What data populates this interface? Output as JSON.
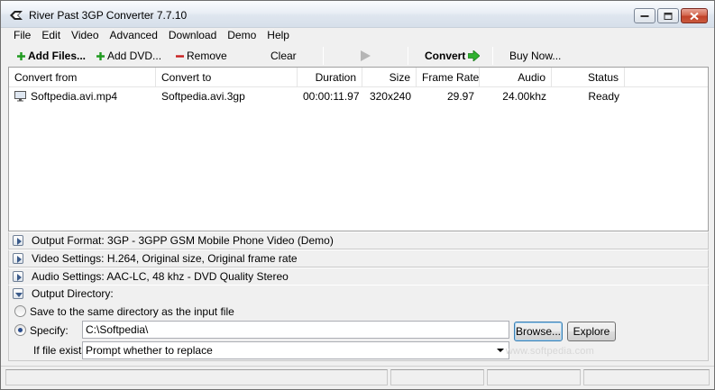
{
  "window": {
    "title": "River Past 3GP Converter 7.7.10"
  },
  "menu": [
    "File",
    "Edit",
    "Video",
    "Advanced",
    "Download",
    "Demo",
    "Help"
  ],
  "toolbar": {
    "add_files": "Add Files...",
    "add_dvd": "Add DVD...",
    "remove": "Remove",
    "clear": "Clear",
    "convert": "Convert",
    "buy_now": "Buy Now..."
  },
  "list": {
    "columns": [
      "Convert from",
      "Convert to",
      "Duration",
      "Size",
      "Frame Rate",
      "Audio",
      "Status"
    ],
    "rows": [
      {
        "from": "Softpedia.avi.mp4",
        "to": "Softpedia.avi.3gp",
        "duration": "00:00:11.97",
        "size": "320x240",
        "frame_rate": "29.97",
        "audio": "24.00khz",
        "status": "Ready"
      }
    ]
  },
  "panels": {
    "output_format": "Output Format: 3GP - 3GPP GSM Mobile Phone Video (Demo)",
    "video_settings": "Video Settings: H.264, Original size, Original frame rate",
    "audio_settings": "Audio Settings: AAC-LC, 48 khz - DVD Quality Stereo",
    "output_directory": "Output Directory:"
  },
  "output": {
    "same_dir_label": "Save to the same directory as the input file",
    "specify_label": "Specify:",
    "path_value": "C:\\Softpedia\\",
    "browse_label": "Browse...",
    "explore_label": "Explore",
    "file_exists_label": "If file exists:",
    "file_exists_value": "Prompt whether to replace"
  },
  "watermark": "www.softpedia.com",
  "colors": {
    "plus_green": "#1f9a1f",
    "remove_red": "#c81e1e",
    "convert_arrow": "#2fb12f"
  }
}
